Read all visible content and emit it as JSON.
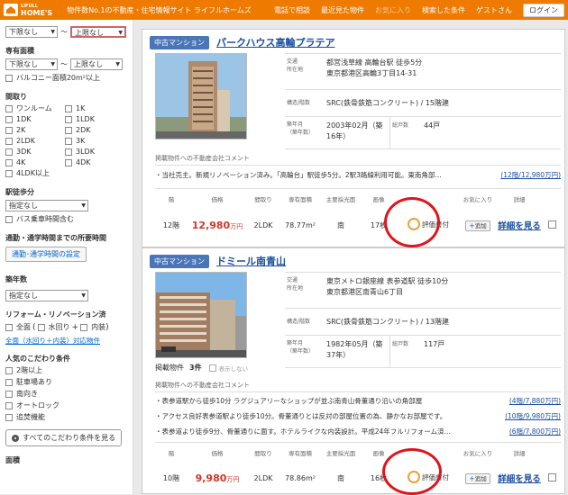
{
  "header": {
    "logo_small": "LIFULL",
    "logo_big": "HOME'S",
    "tagline": "物件数No.1の不動産・住宅情報サイト ライフルホームズ",
    "nav": [
      "電話で相談",
      "最近見た物件",
      "お気に入り",
      "検索した条件",
      "ゲストさん"
    ],
    "login": "ログイン"
  },
  "side": {
    "price_from": "下限なし",
    "price_sep": "～",
    "price_to": "上限なし",
    "area_title": "専有面積",
    "area_from": "下限なし",
    "area_to": "上限なし",
    "balcony": "バルコニー面積20m²以上",
    "layout_title": "間取り",
    "layouts": [
      "ワンルーム",
      "1K",
      "1DK",
      "1LDK",
      "2K",
      "2DK",
      "2LDK",
      "3K",
      "3DK",
      "3LDK",
      "4K",
      "4DK",
      "4LDK以上"
    ],
    "walk_title": "駅徒歩分",
    "walk_value": "指定なし",
    "bus": "バス乗車時間含む",
    "commute_title": "通勤・通学時間までの所要時間",
    "commute_btn": "通勤･通学時間の設定",
    "age_title": "築年数",
    "age_value": "指定なし",
    "reform_title": "リフォーム・リノベーション済",
    "reform_items": [
      "全面",
      "水回り",
      "内装"
    ],
    "reform_link": "全面（水回り＋内装）対応物件",
    "pop_title": "人気のこだわり条件",
    "pop_items": [
      "2階以上",
      "駐車場あり",
      "南向き",
      "オートロック",
      "追焚機能"
    ],
    "all_btn": "すべてのこだわり条件を見る"
  },
  "listings": [
    {
      "badge": "中古マンション",
      "name": "パークハウス高輪プラテア",
      "access_label": "交通\n所在地",
      "access1": "都営浅草線 高輪台駅 徒歩5分",
      "access2": "東京都港区高輪3丁目14-31",
      "struct_label": "構造/階数",
      "struct": "SRC(鉄骨鉄筋コンクリート) / 15階建",
      "built_label": "築年月\n（築年数）",
      "built": "2003年02月（築16年）",
      "units_label": "総戸数",
      "units": "44戸",
      "agent": "掲載物件への不動産会社コメント",
      "comments": [
        {
          "text": "当社売主。新規リノベーション済み。「高輪台」駅徒歩5分。2駅3路線利用可能。東南角部…",
          "more": "(12階/12,980万円)"
        }
      ],
      "heads": [
        "階",
        "価格",
        "間取り",
        "専有面積",
        "主要採光面",
        "画像",
        "",
        "お気に入り",
        "詳細"
      ],
      "floor": "12階",
      "price": "12,980",
      "price_unit": "万円",
      "layout": "2LDK",
      "area": "78.77m²",
      "dir": "南",
      "images": "17枚",
      "stamp": "評価書付",
      "add": "追加",
      "detail": "詳細を見る"
    },
    {
      "badge": "中古マンション",
      "name": "ドミール南青山",
      "access_label": "交通\n所在地",
      "access1": "東京メトロ銀座線 表参道駅 徒歩10分",
      "access2": "東京都港区南青山6丁目",
      "struct_label": "構造/階数",
      "struct": "SRC(鉄骨鉄筋コンクリート) / 13階建",
      "built_label": "築年月\n（築年数）",
      "built": "1982年05月（築37年）",
      "units_label": "総戸数",
      "units": "117戸",
      "count_label": "掲載物件",
      "count": "3件",
      "toggle": "表示しない",
      "agent": "掲載物件への不動産会社コメント",
      "comments": [
        {
          "text": "表参道駅から徒歩10分 ラグジュアリーなショップが並ぶ南青山骨董通り沿いの角部屋",
          "more": "(4階/7,880万円)"
        },
        {
          "text": "アクセス良好表参道駅より徒歩10分。骨董通りとは反対の部屋位置の為、静かなお部屋です。",
          "more": "(10階/9,980万円)"
        },
        {
          "text": "表参道より徒歩9分、骨董通りに面す。ホテルライクな内装設計。平成24年フルリフォーム済…",
          "more": "(6階/7,800万円)"
        }
      ],
      "heads": [
        "階",
        "価格",
        "間取り",
        "専有面積",
        "主要採光面",
        "画像",
        "",
        "お気に入り",
        "詳細"
      ],
      "floor": "10階",
      "price": "9,980",
      "price_unit": "万円",
      "layout": "2LDK",
      "area": "78.86m²",
      "dir": "南",
      "images": "16枚",
      "stamp": "評価書付",
      "add": "追加",
      "detail": "詳細を見る"
    }
  ],
  "side_bottom": "面積"
}
